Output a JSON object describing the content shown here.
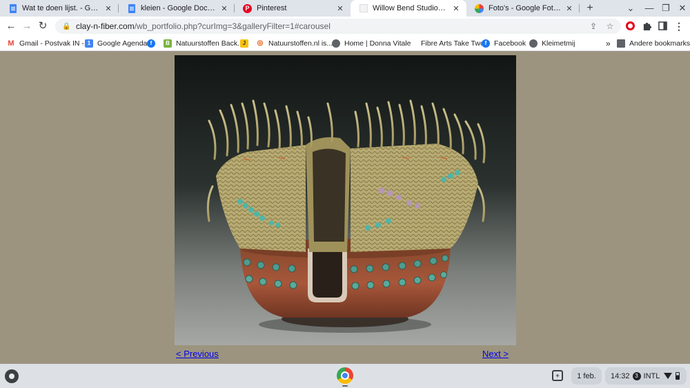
{
  "browser": {
    "tabs": [
      {
        "title": "Wat te doen lijst. - Google Docs",
        "icon": "google-docs-icon",
        "active": false
      },
      {
        "title": "kleien - Google Documenten",
        "icon": "google-docs-icon",
        "active": false
      },
      {
        "title": "Pinterest",
        "icon": "pinterest-icon",
        "active": false
      },
      {
        "title": "Willow Bend Studios - Portfolio",
        "icon": "page-icon",
        "active": true
      },
      {
        "title": "Foto's - Google Foto's",
        "icon": "google-photos-icon",
        "active": false
      }
    ],
    "new_tab_symbol": "+",
    "window_controls": {
      "menu": "⌄",
      "minimize": "—",
      "restore": "❐",
      "close": "✕"
    },
    "close_symbol": "✕"
  },
  "toolbar": {
    "back": "←",
    "forward": "→",
    "reload": "↻",
    "url_host": "clay-n-fiber.com",
    "url_path": "/wb_portfolio.php?curImg=3&galleryFilter=1#carousel",
    "share": "⇪",
    "star": "☆"
  },
  "bookmarks": {
    "items": [
      {
        "label": "Gmail - Postvak IN -...",
        "icon": "gmail-icon",
        "glyph": "M"
      },
      {
        "label": "Google Agenda",
        "icon": "calendar-icon",
        "glyph": "1"
      },
      {
        "label": "Natuurstoffen Back...",
        "icon": "natuurstoffen-icon",
        "glyph": "B"
      },
      {
        "label": "",
        "icon": "j-bookmark-icon",
        "glyph": "J"
      },
      {
        "label": "Natuurstoffen.nl is...",
        "icon": "natuurstoffen-nl-icon",
        "glyph": "◎"
      },
      {
        "label": "Home | Donna Vitale",
        "icon": "globe-icon",
        "glyph": ""
      },
      {
        "label": "Fibre Arts Take Two",
        "icon": "blank-page-icon",
        "glyph": ""
      },
      {
        "label": "Facebook",
        "icon": "facebook-icon",
        "glyph": "f"
      },
      {
        "label": "Kleimetmij",
        "icon": "globe-icon",
        "glyph": ""
      }
    ],
    "overflow": "»",
    "other_bookmarks": "Andere bookmarks"
  },
  "page": {
    "previous_link": "< Previous",
    "next_link": "Next >",
    "image_subject": "fiber-and-clay-vessel-photo",
    "background_color": "#9c947f"
  },
  "shelf": {
    "date": "1 feb.",
    "time": "14:32",
    "notification_count": "3",
    "keyboard_layout": "INTL",
    "desk_symbol": "+"
  }
}
